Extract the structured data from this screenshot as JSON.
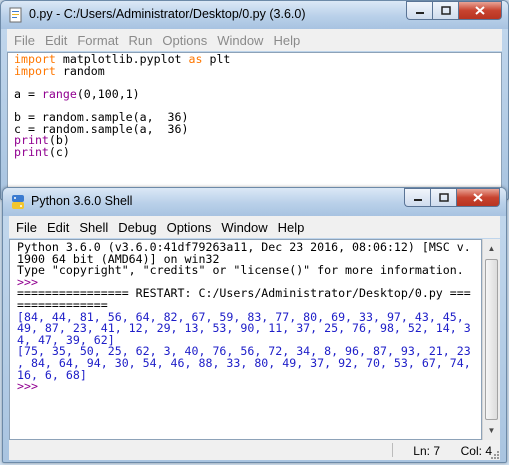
{
  "editor": {
    "title": "0.py - C:/Users/Administrator/Desktop/0.py (3.6.0)",
    "menu": [
      "File",
      "Edit",
      "Format",
      "Run",
      "Options",
      "Window",
      "Help"
    ],
    "code": [
      [
        {
          "t": "import",
          "c": "kw"
        },
        {
          "t": " matplotlib.pyplot ",
          "c": ""
        },
        {
          "t": "as",
          "c": "kw"
        },
        {
          "t": " plt",
          "c": ""
        }
      ],
      [
        {
          "t": "import",
          "c": "kw"
        },
        {
          "t": " random",
          "c": ""
        }
      ],
      [],
      [
        {
          "t": "a = ",
          "c": ""
        },
        {
          "t": "range",
          "c": "bi"
        },
        {
          "t": "(0,100,1)",
          "c": ""
        }
      ],
      [],
      [
        {
          "t": "b = random.sample(a,  36)",
          "c": ""
        }
      ],
      [
        {
          "t": "c = random.sample(a,  36)",
          "c": ""
        }
      ],
      [
        {
          "t": "print",
          "c": "bi"
        },
        {
          "t": "(b)",
          "c": ""
        }
      ],
      [
        {
          "t": "print",
          "c": "bi"
        },
        {
          "t": "(c)",
          "c": ""
        }
      ]
    ]
  },
  "shell": {
    "title": "Python 3.6.0 Shell",
    "menu": [
      "File",
      "Edit",
      "Shell",
      "Debug",
      "Options",
      "Window",
      "Help"
    ],
    "lines": [
      [
        {
          "t": "Python 3.6.0 (v3.6.0:41df79263a11, Dec 23 2016, 08:06:12) [MSC v.",
          "c": ""
        }
      ],
      [
        {
          "t": "1900 64 bit (AMD64)] on win32",
          "c": ""
        }
      ],
      [
        {
          "t": "Type \"copyright\", \"credits\" or \"license()\" for more information.",
          "c": ""
        }
      ],
      [
        {
          "t": ">>> ",
          "c": "prompt"
        }
      ],
      [
        {
          "t": "================ RESTART: C:/Users/Administrator/Desktop/0.py ===",
          "c": ""
        }
      ],
      [
        {
          "t": "=============",
          "c": ""
        }
      ],
      [
        {
          "t": "[84, 44, 81, 56, 64, 82, 67, 59, 83, 77, 80, 69, 33, 97, 43, 45,",
          "c": "out"
        }
      ],
      [
        {
          "t": "49, 87, 23, 41, 12, 29, 13, 53, 90, 11, 37, 25, 76, 98, 52, 14, 3",
          "c": "out"
        }
      ],
      [
        {
          "t": "4, 47, 39, 62]",
          "c": "out"
        }
      ],
      [
        {
          "t": "[75, 35, 50, 25, 62, 3, 40, 76, 56, 72, 34, 8, 96, 87, 93, 21, 23",
          "c": "out"
        }
      ],
      [
        {
          "t": ", 84, 64, 94, 30, 54, 46, 88, 33, 80, 49, 37, 92, 70, 53, 67, 74,",
          "c": "out"
        }
      ],
      [
        {
          "t": "16, 6, 68]",
          "c": "out"
        }
      ],
      [
        {
          "t": ">>> ",
          "c": "prompt"
        }
      ]
    ],
    "status": {
      "line": "Ln: 7",
      "col": "Col: 4"
    }
  },
  "colors": {
    "keyword": "#ff7700",
    "builtin": "#900090",
    "output": "#1d1dc8",
    "close_button": "#c8432f"
  }
}
